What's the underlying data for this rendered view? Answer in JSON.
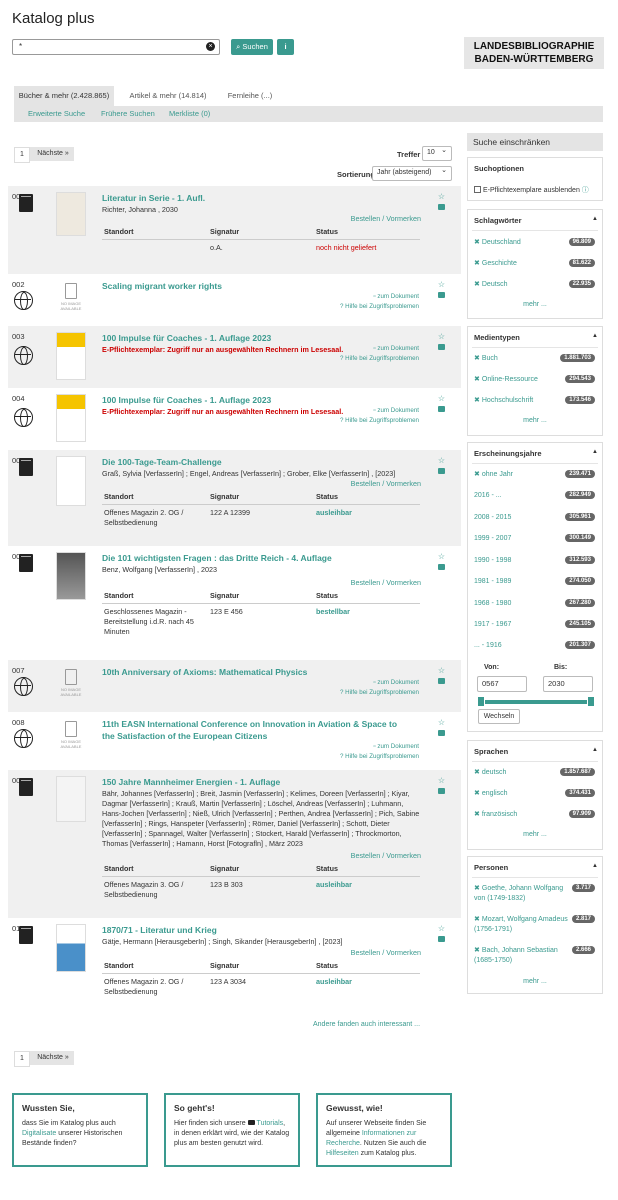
{
  "app_title": "Katalog plus",
  "search": {
    "value": "*",
    "button": "Suchen"
  },
  "logo": {
    "line1": "LANDESBIBLIOGRAPHIE",
    "line2": "BADEN-WÜRTTEMBERG"
  },
  "tabs": [
    "Bücher & mehr (2.428.865)",
    "Artikel & mehr (14.814)",
    "Fernleihe (...)"
  ],
  "subnav": [
    "Erweiterte Suche",
    "Frühere Suchen",
    "Merkliste (0)"
  ],
  "pager": {
    "page": "1",
    "next": "Nächste »"
  },
  "treffer": {
    "label": "Treffer",
    "value": "10"
  },
  "sort": {
    "label": "Sortierung",
    "value": "Jahr (absteigend)"
  },
  "labels": {
    "order": "Bestellen / Vormerken",
    "doc": "zum Dokument",
    "help": "Hilfe bei Zugriffsproblemen",
    "col_standort": "Standort",
    "col_signatur": "Signatur",
    "col_status": "Status",
    "noimg": "NO IMAGE AVAILABLE",
    "more_results": "Andere fanden auch interessant ..."
  },
  "records": [
    {
      "num": "001",
      "title": "Literatur in Serie - 1. Aufl.",
      "author": "Richter, Johanna , 2030",
      "standort": "",
      "signatur": "o.A.",
      "status": "noch nicht geliefert"
    },
    {
      "num": "002",
      "title": "Scaling migrant worker rights"
    },
    {
      "num": "003",
      "title": "100 Impulse für Coaches - 1. Auflage 2023",
      "warn": "E-Pflichtexemplar: Zugriff nur an ausgewählten Rechnern im Lesesaal."
    },
    {
      "num": "004",
      "title": "100 Impulse für Coaches - 1. Auflage 2023",
      "warn": "E-Pflichtexemplar: Zugriff nur an ausgewählten Rechnern im Lesesaal."
    },
    {
      "num": "005",
      "title": "Die 100-Tage-Team-Challenge",
      "author": "Graß, Sylvia [VerfasserIn] ; Engel, Andreas [VerfasserIn] ; Grober, Elke [VerfasserIn] , [2023]",
      "standort": "Offenes Magazin 2. OG / Selbstbedienung",
      "signatur": "122 A 12399",
      "status": "ausleihbar"
    },
    {
      "num": "006",
      "title": "Die 101 wichtigsten Fragen : das Dritte Reich - 4. Auflage",
      "author": "Benz, Wolfgang [VerfasserIn] , 2023",
      "standort": "Geschlossenes Magazin - Bereitstellung i.d.R. nach 45 Minuten",
      "signatur": "123 E 456",
      "status": "bestellbar"
    },
    {
      "num": "007",
      "title": "10th Anniversary of Axioms: Mathematical Physics"
    },
    {
      "num": "008",
      "title": "11th EASN International Conference on Innovation in Aviation & Space to the Satisfaction of the European Citizens"
    },
    {
      "num": "009",
      "title": "150 Jahre Mannheimer Energien - 1. Auflage",
      "author": "Bähr, Johannes [VerfasserIn] ; Breit, Jasmin [VerfasserIn] ; Kelimes, Doreen [VerfasserIn] ; Kiyar, Dagmar [VerfasserIn] ; Krauß, Martin [VerfasserIn] ; Löschel, Andreas [VerfasserIn] ; Luhmann, Hans-Jochen [VerfasserIn] ; Nieß, Ulrich [VerfasserIn] ; Perthen, Andrea [VerfasserIn] ; Pich, Sabine [VerfasserIn] ; Rings, Hanspeter [VerfasserIn] ; Römer, Daniel [VerfasserIn] ; Schott, Dieter [VerfasserIn] ; Spannagel, Walter [VerfasserIn] ; Stockert, Harald [VerfasserIn] ; Throckmorton, Thomas [VerfasserIn] ; Hamann, Horst [Fotografln] , März 2023",
      "standort": "Offenes Magazin 3. OG / Selbstbedienung",
      "signatur": "123 B 303",
      "status": "ausleihbar"
    },
    {
      "num": "010",
      "title": "1870/71 - Literatur und Krieg",
      "author": "Gätje, Hermann [HerausgeberIn] ; Singh, Sikander [HerausgeberIn] , [2023]",
      "standort": "Offenes Magazin 2. OG / Selbstbedienung",
      "signatur": "123 A 3034",
      "status": "ausleihbar"
    }
  ],
  "sidebar": {
    "title": "Suche einschränken",
    "options": {
      "title": "Suchoptionen",
      "checkbox": "E-Pflichtexemplare ausblenden"
    },
    "more": "mehr ...",
    "schlagwoerter": {
      "title": "Schlagwörter",
      "items": [
        {
          "label": "Deutschland",
          "count": "96.809"
        },
        {
          "label": "Geschichte",
          "count": "81.622"
        },
        {
          "label": "Deutsch",
          "count": "22.935"
        }
      ]
    },
    "medientypen": {
      "title": "Medientypen",
      "items": [
        {
          "label": "Buch",
          "count": "1.881.703"
        },
        {
          "label": "Online-Ressource",
          "count": "294.543"
        },
        {
          "label": "Hochschulschrift",
          "count": "173.546"
        }
      ]
    },
    "jahre": {
      "title": "Erscheinungsjahre",
      "items": [
        {
          "label": "ohne Jahr",
          "count": "239.471"
        },
        {
          "label": "2016 -  ...",
          "count": "282.949"
        },
        {
          "label": "2008 - 2015",
          "count": "305.961"
        },
        {
          "label": "1999 - 2007",
          "count": "300.149"
        },
        {
          "label": "1990 - 1998",
          "count": "312.593"
        },
        {
          "label": "1981 - 1989",
          "count": "274.050"
        },
        {
          "label": "1968 - 1980",
          "count": "267.280"
        },
        {
          "label": "1917 - 1967",
          "count": "245.105"
        },
        {
          "label": "...  - 1916",
          "count": "201.307"
        }
      ],
      "von_label": "Von:",
      "bis_label": "Bis:",
      "von": "0567",
      "bis": "2030",
      "button": "Wechseln"
    },
    "sprachen": {
      "title": "Sprachen",
      "items": [
        {
          "label": "deutsch",
          "count": "1.857.687"
        },
        {
          "label": "englisch",
          "count": "374.431"
        },
        {
          "label": "französisch",
          "count": "97.909"
        }
      ]
    },
    "personen": {
      "title": "Personen",
      "items": [
        {
          "label": "Goethe, Johann Wolfgang von (1749-1832)",
          "count": "3.717"
        },
        {
          "label": "Mozart, Wolfgang Amadeus (1756-1791)",
          "count": "2.817"
        },
        {
          "label": "Bach, Johann Sebastian (1685-1750)",
          "count": "2.666"
        }
      ]
    }
  },
  "boxes": [
    {
      "title": "Wussten Sie,",
      "t1": "dass Sie im Katalog plus auch ",
      "link": "Digitalisate",
      "t2": " unserer Historischen Bestände finden?"
    },
    {
      "title": "So geht's!",
      "t1": "Hier finden sich unsere ",
      "link": "Tutorials",
      "t2": ", in denen erklärt wird, wie der Katalog plus am besten genutzt wird."
    },
    {
      "title": "Gewusst, wie!",
      "t1": "Auf unserer Webseite finden Sie allgemeine ",
      "link": "Informationen zur Recherche",
      "t2": ". Nutzen Sie auch die ",
      "link2": "Hilfeseiten",
      "t3": " zum Katalog plus."
    }
  ]
}
